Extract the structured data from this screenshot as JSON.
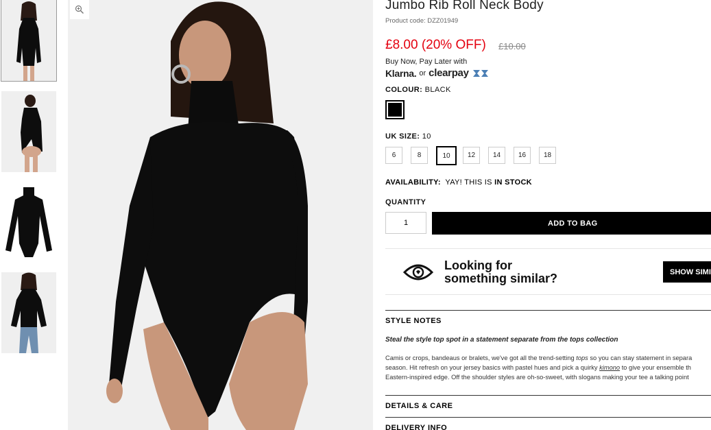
{
  "product": {
    "title": "Jumbo Rib Roll Neck Body",
    "code": "Product code: DZZ01949",
    "price": "£8.00 (20% OFF)",
    "old_price": "£10.00"
  },
  "payment": {
    "paylater": "Buy Now, Pay Later with",
    "klarna": "Klarna.",
    "or": "or",
    "clearpay": "clearpay"
  },
  "colour": {
    "label": "COLOUR:",
    "value": "BLACK",
    "swatch_color": "#000000"
  },
  "size": {
    "label": "UK SIZE:",
    "value": "10",
    "options": [
      "6",
      "8",
      "10",
      "12",
      "14",
      "16",
      "18"
    ],
    "selected": "10"
  },
  "availability": {
    "label": "AVAILABILITY:",
    "text": "YAY! THIS IS",
    "status": "IN STOCK"
  },
  "quantity": {
    "label": "QUANTITY",
    "value": "1"
  },
  "add_to_bag": "ADD TO BAG",
  "similar": {
    "line1": "Looking for",
    "line2": "something similar?",
    "button": "SHOW SIMI"
  },
  "style_notes": {
    "header": "STYLE NOTES",
    "intro": "Steal the style top spot in a statement separate from the tops collection",
    "line1_a": "Camis or crops, bandeaus or bralets, we've got all the trend-setting ",
    "line1_em": "tops",
    "line1_b": " so you can stay statement in separa",
    "line2_a": "season. Hit refresh on your jersey basics with pastel hues and pick a quirky ",
    "line2_link": "kimono",
    "line2_b": " to give your ensemble th",
    "line3": "Eastern-inspired edge. Off the shoulder styles are oh-so-sweet, with slogans making your tee a talking point"
  },
  "details_header": "DETAILS & CARE",
  "delivery_header": "DELIVERY INFO",
  "colors": {
    "price_red": "#e4000f",
    "button_black": "#000000",
    "clearpay_accent": "#4b7fb5"
  }
}
